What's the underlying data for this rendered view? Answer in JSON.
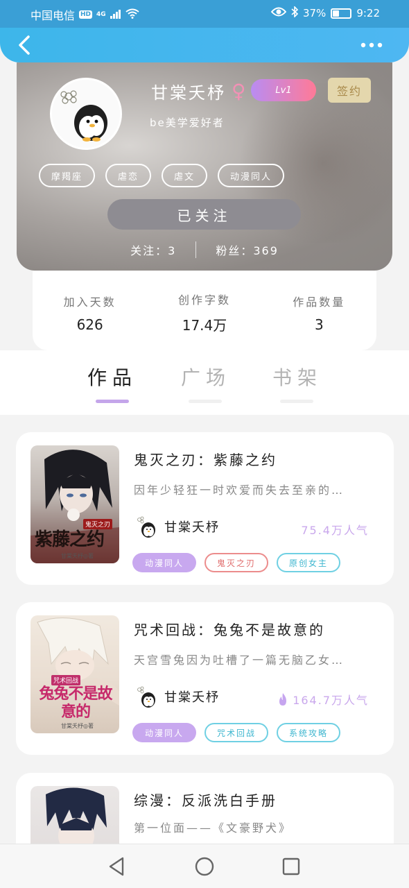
{
  "status_bar": {
    "carrier": "中国电信",
    "hd_badge": "HD",
    "network": "4G",
    "battery_percent": "37%",
    "battery_level": 0.37,
    "time": "9:22"
  },
  "nav": {
    "back_icon": "chevron-left-icon",
    "more_icon": "more-dots-icon"
  },
  "profile": {
    "username": "甘棠夭杼",
    "gender_symbol": "♀",
    "level": "Lv1",
    "sign_badge": "签约",
    "bio": "be美学爱好者",
    "tags": [
      "摩羯座",
      "虐恋",
      "虐文",
      "动漫同人"
    ],
    "follow_button": "已关注",
    "following_label": "关注：",
    "following_count": "3",
    "fans_label": "粉丝：",
    "fans_count": "369"
  },
  "stats": [
    {
      "label": "加入天数",
      "value": "626"
    },
    {
      "label": "创作字数",
      "value": "17.4万"
    },
    {
      "label": "作品数量",
      "value": "3"
    }
  ],
  "tabs": [
    {
      "label": "作品",
      "active": true
    },
    {
      "label": "广场",
      "active": false
    },
    {
      "label": "书架",
      "active": false
    }
  ],
  "books": [
    {
      "title": "鬼灭之刃：紫藤之约",
      "description": "因年少轻狂一时欢爱而失去至亲的…",
      "author": "甘棠夭杼",
      "popularity": "75.4万人气",
      "hot": false,
      "cover_title": "紫藤之约",
      "cover_subtitle": "鬼灭之刃",
      "cover_author": "甘棠夭杼◎著",
      "genres": [
        {
          "label": "动漫同人",
          "style": "filled"
        },
        {
          "label": "鬼灭之刃",
          "style": "red"
        },
        {
          "label": "原创女主",
          "style": "cyan"
        }
      ]
    },
    {
      "title": "咒术回战：兔兔不是故意的",
      "description": "天宫雪兔因为吐槽了一篇无脑乙女…",
      "author": "甘棠夭杼",
      "popularity": "164.7万人气",
      "hot": true,
      "cover_title": "兔兔不是故意的",
      "cover_subtitle": "咒术回战",
      "cover_author": "甘棠夭杼◎著",
      "genres": [
        {
          "label": "动漫同人",
          "style": "filled"
        },
        {
          "label": "咒术回战",
          "style": "cyan"
        },
        {
          "label": "系统攻略",
          "style": "cyan"
        }
      ]
    },
    {
      "title": "综漫：反派洗白手册",
      "description": "第一位面——《文豪野犬》",
      "author": "",
      "popularity": "",
      "hot": false,
      "cover_title": "",
      "cover_subtitle": "",
      "cover_author": "",
      "genres": []
    }
  ],
  "bottom_nav": {
    "back_icon": "triangle-back-icon",
    "home_icon": "circle-home-icon",
    "recent_icon": "square-recents-icon"
  },
  "colors": {
    "accent": "#c4a5ea",
    "header_blue": "#3db6ea",
    "sign_gold": "#e4d7ad"
  }
}
